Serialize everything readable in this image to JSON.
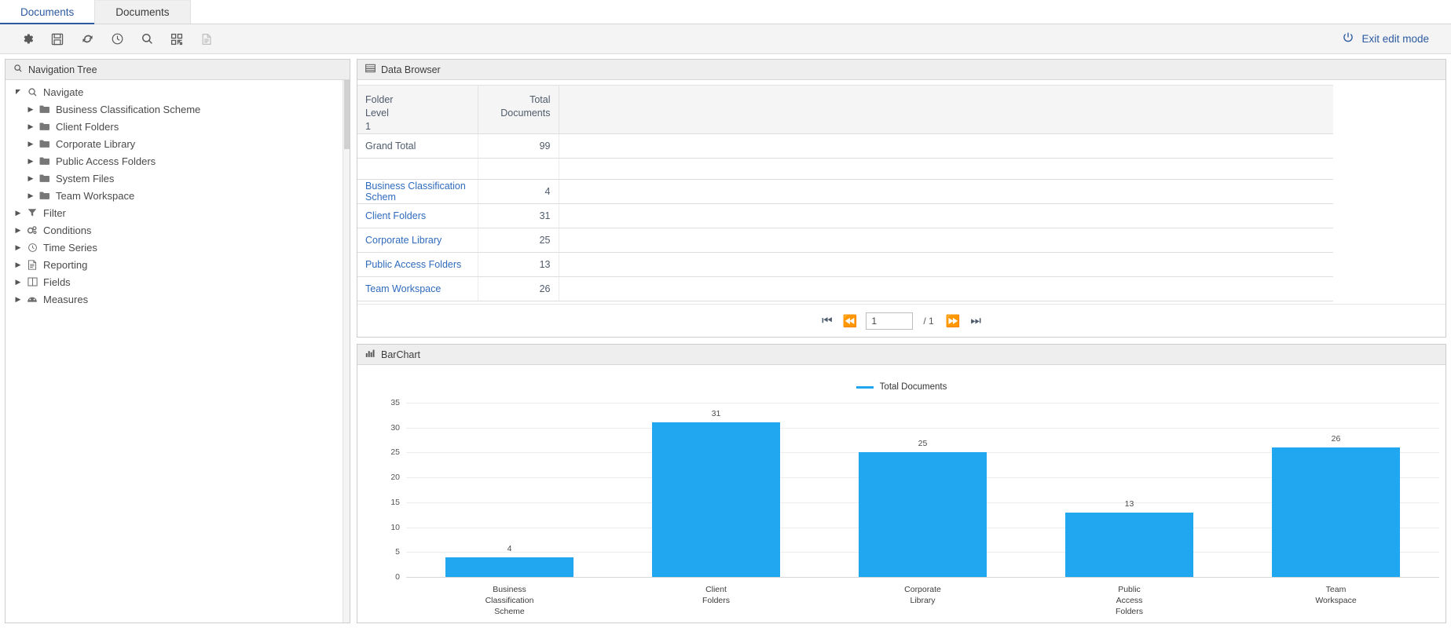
{
  "tabs": [
    {
      "label": "Documents",
      "active": true
    },
    {
      "label": "Documents",
      "active": false
    }
  ],
  "toolbar": {
    "icons": [
      {
        "name": "gear-icon",
        "disabled": false
      },
      {
        "name": "save-icon",
        "disabled": false
      },
      {
        "name": "refresh-icon",
        "disabled": false
      },
      {
        "name": "clock-icon",
        "disabled": false
      },
      {
        "name": "search-icon",
        "disabled": false
      },
      {
        "name": "qrcode-icon",
        "disabled": false
      },
      {
        "name": "document-icon",
        "disabled": true
      }
    ],
    "exit_edit_label": "Exit edit mode"
  },
  "navigation": {
    "title": "Navigation Tree",
    "items": [
      {
        "label": "Navigate",
        "level": 1,
        "icon": "search-icon",
        "expanded": true
      },
      {
        "label": "Business Classification Scheme",
        "level": 2,
        "icon": "folder-icon",
        "expanded": false
      },
      {
        "label": "Client Folders",
        "level": 2,
        "icon": "folder-icon",
        "expanded": false
      },
      {
        "label": "Corporate Library",
        "level": 2,
        "icon": "folder-icon",
        "expanded": false
      },
      {
        "label": "Public Access Folders",
        "level": 2,
        "icon": "folder-icon",
        "expanded": false
      },
      {
        "label": "System Files",
        "level": 2,
        "icon": "folder-icon",
        "expanded": false
      },
      {
        "label": "Team Workspace",
        "level": 2,
        "icon": "folder-icon",
        "expanded": false
      },
      {
        "label": "Filter",
        "level": 1,
        "icon": "filter-icon",
        "expanded": false
      },
      {
        "label": "Conditions",
        "level": 1,
        "icon": "conditions-icon",
        "expanded": false
      },
      {
        "label": "Time Series",
        "level": 1,
        "icon": "clock-icon",
        "expanded": false
      },
      {
        "label": "Reporting",
        "level": 1,
        "icon": "report-icon",
        "expanded": false
      },
      {
        "label": "Fields",
        "level": 1,
        "icon": "columns-icon",
        "expanded": false
      },
      {
        "label": "Measures",
        "level": 1,
        "icon": "measures-icon",
        "expanded": false
      }
    ]
  },
  "data_browser": {
    "title": "Data Browser",
    "columns": [
      "Folder\nLevel\n1",
      "Total\nDocuments",
      ""
    ],
    "column_lines": [
      [
        "Folder",
        "Level",
        "1"
      ],
      [
        "Total",
        "Documents"
      ],
      []
    ],
    "rows": [
      {
        "label": "Grand Total",
        "value": "99",
        "link": false
      },
      {
        "label": "",
        "value": "",
        "link": false,
        "spacer": true
      },
      {
        "label": "Business Classification Schem",
        "value": "4",
        "link": true
      },
      {
        "label": "Client Folders",
        "value": "31",
        "link": true
      },
      {
        "label": "Corporate Library",
        "value": "25",
        "link": true
      },
      {
        "label": "Public Access Folders",
        "value": "13",
        "link": true
      },
      {
        "label": "Team Workspace",
        "value": "26",
        "link": true
      }
    ],
    "pager": {
      "first": "⏮",
      "prev": "⏪",
      "page_value": "1",
      "total": "/ 1",
      "next": "⏩",
      "last": "⏭"
    }
  },
  "chart_panel": {
    "title": "BarChart"
  },
  "chart_data": {
    "type": "bar",
    "title": "",
    "categories": [
      "Business\nClassification\nScheme",
      "Client\nFolders",
      "Corporate\nLibrary",
      "Public\nAccess\nFolders",
      "Team\nWorkspace"
    ],
    "category_lines": [
      [
        "Business",
        "Classification",
        "Scheme"
      ],
      [
        "Client",
        "Folders"
      ],
      [
        "Corporate",
        "Library"
      ],
      [
        "Public",
        "Access",
        "Folders"
      ],
      [
        "Team",
        "Workspace"
      ]
    ],
    "values": [
      4,
      31,
      25,
      13,
      26
    ],
    "series": [
      {
        "name": "Total Documents",
        "values": [
          4,
          31,
          25,
          13,
          26
        ],
        "color": "#21a7f0"
      }
    ],
    "legend": [
      "Total Documents"
    ],
    "legend_position": "top-center",
    "yticks": [
      0,
      5,
      10,
      15,
      20,
      25,
      30,
      35
    ],
    "ylim": [
      0,
      35
    ],
    "xlabel": "",
    "ylabel": "",
    "grid": true,
    "data_labels": [
      "4",
      "31",
      "25",
      "13",
      "26"
    ]
  },
  "colors": {
    "accent": "#2c5aa0",
    "bar": "#21a7f0",
    "link": "#2f6bbd"
  }
}
